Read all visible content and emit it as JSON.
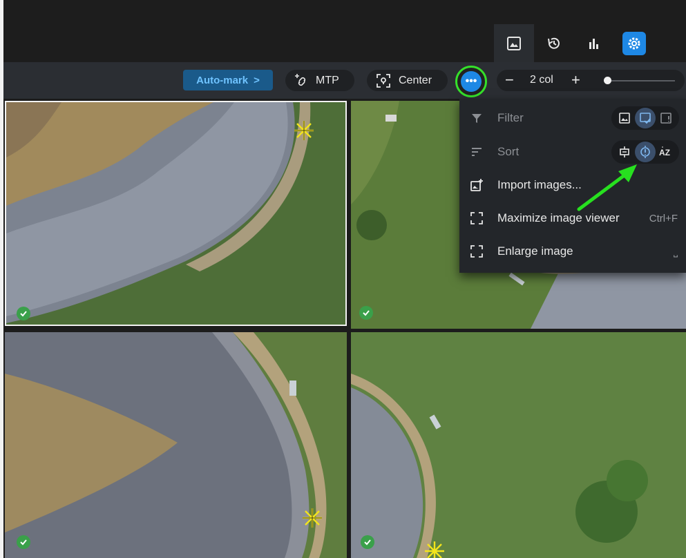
{
  "tabs": [
    {
      "icon": "image-gallery-icon",
      "active": true
    },
    {
      "icon": "history-icon",
      "active": false
    },
    {
      "icon": "bar-chart-icon",
      "active": false
    },
    {
      "icon": "settings-gear-icon",
      "active": false
    }
  ],
  "toolbar": {
    "automark_label": "Auto-mark",
    "automark_chevron": ">",
    "mtp_label": "MTP",
    "center_label": "Center",
    "more_glyph": "•••",
    "zoom_minus": "−",
    "zoom_value": "2 col",
    "zoom_plus": "+",
    "zoom_slider_level": 0.03
  },
  "menu": {
    "filter_label": "Filter",
    "sort_label": "Sort",
    "import_label": "Import images...",
    "maximize_label": "Maximize image viewer",
    "maximize_shortcut": "Ctrl+F",
    "enlarge_label": "Enlarge image",
    "enlarge_shortcut": "⎵"
  },
  "colors": {
    "accent": "#1e88e5",
    "highlight_ring": "#35e02a",
    "arrow": "#27e01f",
    "check": "#3aa04a",
    "marker": "#f3e41c"
  }
}
